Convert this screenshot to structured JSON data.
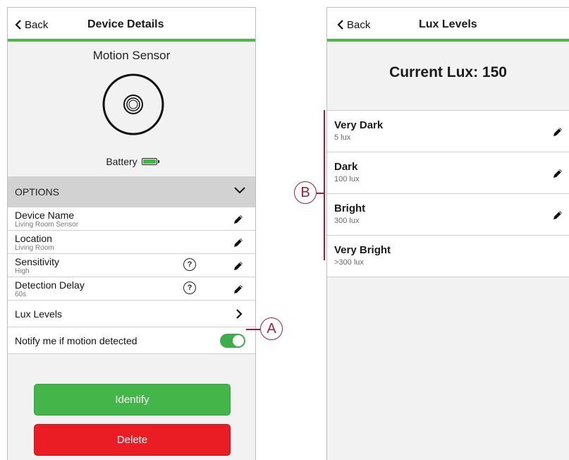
{
  "left_screen": {
    "back_label": "Back",
    "title": "Device Details",
    "device_type": "Motion Sensor",
    "battery_label": "Battery",
    "options_header": "OPTIONS",
    "options": [
      {
        "label": "Device Name",
        "value": "Living Room Sensor"
      },
      {
        "label": "Location",
        "value": "Living Room"
      },
      {
        "label": "Sensitivity",
        "value": "High"
      },
      {
        "label": "Detection Delay",
        "value": "60s"
      }
    ],
    "lux_levels_label": "Lux Levels",
    "notify_label": "Notify me if motion detected",
    "notify_enabled": true,
    "identify_label": "Identify",
    "delete_label": "Delete"
  },
  "right_screen": {
    "back_label": "Back",
    "title": "Lux Levels",
    "current_lux": "Current Lux: 150",
    "levels": [
      {
        "name": "Very Dark",
        "value": "5 lux",
        "editable": true
      },
      {
        "name": "Dark",
        "value": "100 lux",
        "editable": true
      },
      {
        "name": "Bright",
        "value": "300 lux",
        "editable": true
      },
      {
        "name": "Very Bright",
        "value": ">300 lux",
        "editable": false
      }
    ]
  },
  "callouts": {
    "a": "A",
    "b": "B"
  },
  "colors": {
    "accent_green": "#4fb748",
    "delete_red": "#ea1c24",
    "callout": "#a31d3a"
  },
  "icons": [
    "chevron-left-icon",
    "motion-sensor-icon",
    "battery-icon",
    "chevron-down-icon",
    "pencil-icon",
    "help-icon",
    "chevron-right-icon",
    "toggle-switch"
  ]
}
